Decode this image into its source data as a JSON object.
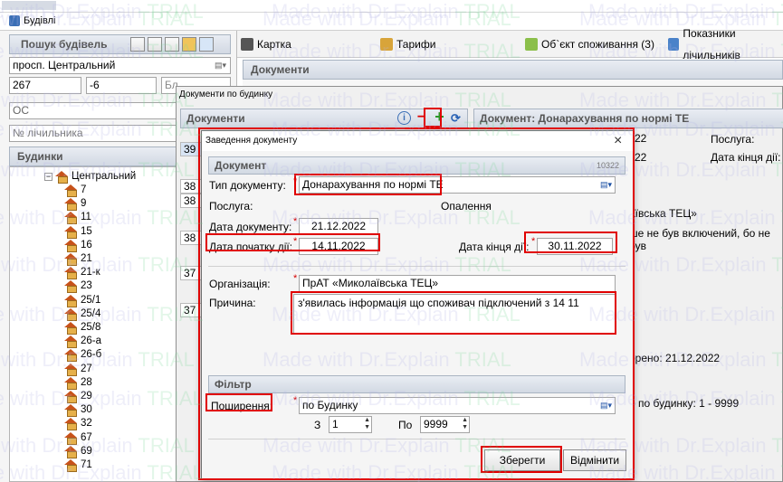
{
  "window": {
    "title": "Будівлі"
  },
  "search_panel": {
    "title": "Пошук будівель",
    "street_value": "просп. Центральний",
    "house_value": "267",
    "korpus_value": "-6",
    "other_button_label": "Бл",
    "account_value": "ОС",
    "meter_placeholder": "№ лічильника"
  },
  "buildings": {
    "title": "Будинки",
    "root_label": "Центральний",
    "items": [
      "7",
      "9",
      "11",
      "15",
      "16",
      "21",
      "21-к",
      "23",
      "25/1",
      "25/4",
      "25/8",
      "26-а",
      "26-б",
      "27",
      "28",
      "29",
      "30",
      "32",
      "67",
      "69",
      "71"
    ]
  },
  "top_tabs": {
    "card": "Картка",
    "tariffs": "Тарифи",
    "consumption": "Об`єкт споживання (3)",
    "meters": "Показники лічильників"
  },
  "documents_bg": {
    "header": "Документи",
    "by_house_title": "Документи по будинку",
    "list_header": "Документи",
    "doc_title": "Документ: Донарахування по нормі ТЕ",
    "left_numbers": [
      "39",
      "38",
      "38",
      "38",
      "37",
      "37"
    ],
    "right_snippets": {
      "n22a": "22",
      "n22b": "22",
      "service_label": "Послуга:",
      "end_date_label": "Дата кінця дії:",
      "org_snippet": "аївська ТЕЦ»",
      "reason_snippet": "ше не був включений, бо не був",
      "created_snippet": "орено: 21.12.2022",
      "range_snippet": "р по будинку: 1 - 9999"
    }
  },
  "dialog": {
    "title": "Заведення документу",
    "close_label": "×",
    "section_document": "Документ",
    "doc_number": "10322",
    "doc_type_label": "Тип документу:",
    "doc_type_value": "Донарахування по нормі ТЕ",
    "service_label": "Послуга:",
    "service_value": "Опалення",
    "doc_date_label": "Дата документу:",
    "doc_date_value": "21.12.2022",
    "start_date_label": "Дата початку дії:",
    "start_date_value": "14.11.2022",
    "end_date_label": "Дата кінця дії:",
    "end_date_value": "30.11.2022",
    "org_label": "Організація:",
    "org_value": "ПрАТ «Миколаївська ТЕЦ»",
    "reason_label": "Причина:",
    "reason_value": "з'явилась інформація що споживач підключений з 14 11",
    "section_filter": "Фільтр",
    "spread_label": "Поширення:",
    "spread_value": "по Будинку",
    "from_label": "З",
    "from_value": "1",
    "to_label": "По",
    "to_value": "9999",
    "save_label": "Зберегти",
    "cancel_label": "Відмінити",
    "required_mark": "*"
  },
  "watermark": {
    "part1": "Made with Dr.Explain ",
    "part2": "TRIAL"
  },
  "colors": {
    "highlight": "#e00000",
    "selection": "#0a64c8",
    "panel_header": "#d7dee8"
  }
}
